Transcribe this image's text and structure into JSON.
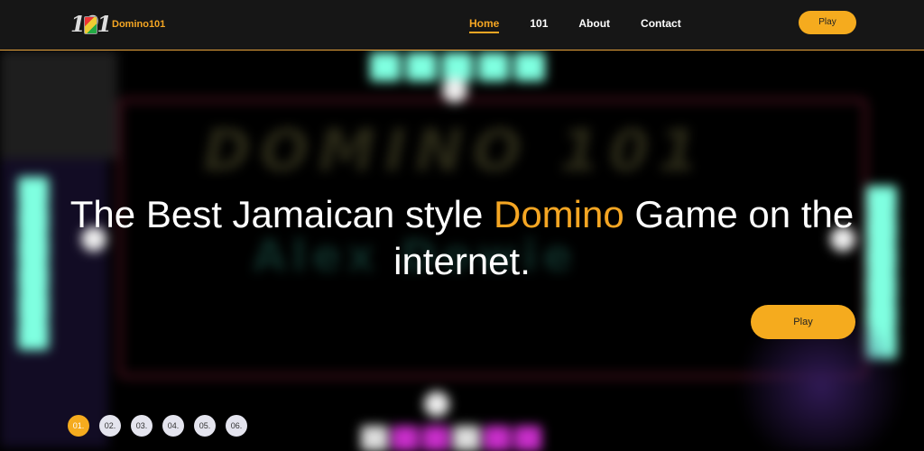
{
  "header": {
    "logo_mark": "101",
    "logo_text": "Domino101",
    "nav": [
      "Home",
      "101",
      "About",
      "Contact"
    ],
    "active_nav": "Home",
    "play_label": "Play"
  },
  "hero": {
    "title_before": "The Best Jamaican style ",
    "title_accent": "Domino",
    "title_after": " Game on the internet.",
    "play_label": "Play"
  },
  "pager": [
    "01.",
    "02.",
    "03.",
    "04.",
    "05.",
    "06."
  ],
  "pager_active": "01.",
  "colors": {
    "accent": "#f5a623",
    "button": "#f5ab1e",
    "header_bg": "#161616"
  }
}
